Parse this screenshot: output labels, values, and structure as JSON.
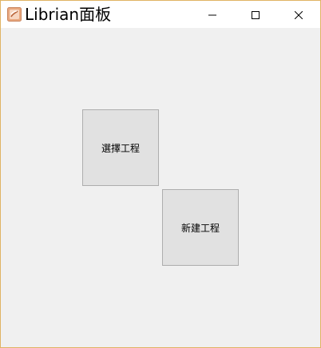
{
  "window": {
    "title": "Librian面板",
    "app_icon": "librian-app-icon",
    "border_color": "#e0b463",
    "controls": {
      "minimize_icon": "minimize-icon",
      "maximize_icon": "maximize-icon",
      "close_icon": "close-icon"
    }
  },
  "main": {
    "open_project_label": "選擇工程",
    "new_project_label": "新建工程"
  }
}
